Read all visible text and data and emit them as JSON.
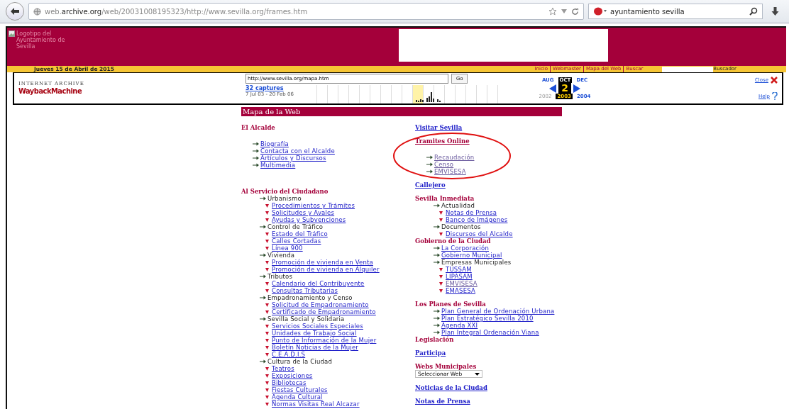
{
  "browser": {
    "address": "web.**archive.org**/web/20031008195323/http://www.sevilla.org/frames.htm",
    "search": "ayuntamiento sevilla"
  },
  "site_header": {
    "logo_alt": "Logotipo del Ayuntamiento de Sevilla",
    "date": "Jueves 15 de Abril de 2015",
    "nav": [
      "Inicio",
      "Webmaster",
      "Mapa del Web",
      "Buscar"
    ],
    "search_label": "Buscador"
  },
  "wayback": {
    "logo_top": "INTERNET ARCHIVE",
    "logo": "WaybackMachine",
    "url": "http://www.sevilla.org/mapa.htm",
    "go": "Go",
    "captures": "32 captures",
    "range": "7 Jul 03 - 20 Feb 06",
    "months": [
      {
        "label": "AUG",
        "selected": false
      },
      {
        "label": "OCT",
        "selected": true
      },
      {
        "label": "DEC",
        "selected": false
      }
    ],
    "day": "2",
    "years": [
      {
        "label": "2002",
        "selected": false,
        "disabled": true
      },
      {
        "label": "2003",
        "selected": true,
        "disabled": false
      },
      {
        "label": "2004",
        "selected": false,
        "disabled": false
      }
    ],
    "close": "Close",
    "help": "Help"
  },
  "page_title": "Mapa de la Web",
  "columns": [
    {
      "groups": [
        [
          {
            "heading": {
              "text": "El Alcalde",
              "kind": "title"
            },
            "kind": "spaced",
            "items": [
              {
                "text": "Biografía",
                "kind": "arrow-link",
                "visited": false
              },
              {
                "text": "Contacta con el Alcalde",
                "kind": "arrow-link",
                "visited": false
              },
              {
                "text": "Artículos y Discursos",
                "kind": "arrow-link",
                "visited": false
              },
              {
                "text": "Multimedia",
                "kind": "arrow-link",
                "visited": false
              }
            ]
          }
        ],
        [
          {
            "heading": {
              "text": "Al Servicio del Ciudadano",
              "kind": "title"
            },
            "kind": "compact",
            "items": [
              {
                "text": "Urbanismo",
                "kind": "arrow-text",
                "children": [
                  {
                    "text": "Procedimientos y Trámites",
                    "kind": "bullet-link",
                    "visited": false
                  },
                  {
                    "text": "Solicitudes y Avales",
                    "kind": "bullet-link",
                    "visited": false
                  },
                  {
                    "text": "Ayudas y Subvenciones",
                    "kind": "bullet-link",
                    "visited": false
                  }
                ]
              },
              {
                "text": "Control de Tráfico",
                "kind": "arrow-text",
                "children": [
                  {
                    "text": "Estado del Tráfico",
                    "kind": "bullet-link",
                    "visited": false
                  },
                  {
                    "text": "Calles Cortadas",
                    "kind": "bullet-link",
                    "visited": false
                  },
                  {
                    "text": "Línea 900",
                    "kind": "bullet-link",
                    "visited": false
                  }
                ]
              },
              {
                "text": "Vivienda",
                "kind": "arrow-text",
                "children": [
                  {
                    "text": "Promoción de vivienda en Venta",
                    "kind": "bullet-link",
                    "visited": false
                  },
                  {
                    "text": "Promoción de vivienda en Alquiler",
                    "kind": "bullet-link",
                    "visited": false
                  }
                ]
              },
              {
                "text": "Tributos",
                "kind": "arrow-text",
                "children": [
                  {
                    "text": "Calendario del Contribuyente",
                    "kind": "bullet-link",
                    "visited": false
                  },
                  {
                    "text": "Consultas Tributarias",
                    "kind": "bullet-link",
                    "visited": false
                  }
                ]
              },
              {
                "text": "Empadronamiento y Censo",
                "kind": "arrow-text",
                "children": [
                  {
                    "text": "Solicitud de Empadronamiento",
                    "kind": "bullet-link",
                    "visited": false
                  },
                  {
                    "text": "Certificado de Empadronamiento",
                    "kind": "bullet-link",
                    "visited": false
                  }
                ]
              },
              {
                "text": "Sevilla Social y Solidaria",
                "kind": "arrow-text",
                "children": [
                  {
                    "text": "Servicios Sociales Especiales",
                    "kind": "bullet-link",
                    "visited": false
                  },
                  {
                    "text": "Unidades de Trabajo Social",
                    "kind": "bullet-link",
                    "visited": false
                  },
                  {
                    "text": "Punto de Información de la Mujer",
                    "kind": "bullet-link",
                    "visited": false
                  },
                  {
                    "text": "Boletín Noticias de la Mujer",
                    "kind": "bullet-link",
                    "visited": false
                  },
                  {
                    "text": "C.E.A.D.I.S",
                    "kind": "bullet-link",
                    "visited": false
                  }
                ]
              },
              {
                "text": "Cultura de la Ciudad",
                "kind": "arrow-text",
                "children": [
                  {
                    "text": "Teatros",
                    "kind": "bullet-link",
                    "visited": false
                  },
                  {
                    "text": "Exposiciones",
                    "kind": "bullet-link",
                    "visited": false
                  },
                  {
                    "text": "Bibliotecas",
                    "kind": "bullet-link",
                    "visited": false
                  },
                  {
                    "text": "Fiestas Culturales",
                    "kind": "bullet-link",
                    "visited": false
                  },
                  {
                    "text": "Agenda Cultural",
                    "kind": "bullet-link",
                    "visited": false
                  },
                  {
                    "text": "Normas Visitas Real Alcazar",
                    "kind": "bullet-link",
                    "visited": false
                  }
                ]
              }
            ]
          }
        ]
      ]
    },
    {
      "groups": [
        [
          {
            "heading": {
              "text": "Visitar Sevilla",
              "kind": "link"
            },
            "kind": "compact"
          }
        ],
        [
          {
            "heading": {
              "text": "Tramites Online",
              "kind": "title-link"
            },
            "kind": "spaced",
            "items": [
              {
                "text": "Recaudación",
                "kind": "arrow-link",
                "visited": true
              },
              {
                "text": "Censo",
                "kind": "arrow-link",
                "visited": true
              },
              {
                "text": "EMVISESA",
                "kind": "arrow-link",
                "visited": true
              }
            ]
          }
        ],
        [
          {
            "heading": {
              "text": "Callejero",
              "kind": "link"
            },
            "kind": "compact"
          }
        ],
        [
          {
            "heading": {
              "text": "Sevilla Inmediata",
              "kind": "title"
            },
            "kind": "compact",
            "items": [
              {
                "text": "Actualidad",
                "kind": "arrow-text",
                "children": [
                  {
                    "text": "Notas de Prensa",
                    "kind": "bullet-link",
                    "visited": false
                  },
                  {
                    "text": "Banco de Imágenes",
                    "kind": "bullet-link",
                    "visited": false
                  }
                ]
              },
              {
                "text": "Documentos",
                "kind": "arrow-text",
                "children": [
                  {
                    "text": "Discursos del Alcalde",
                    "kind": "bullet-link",
                    "visited": false
                  }
                ]
              }
            ]
          },
          {
            "heading": {
              "text": "Gobierno de la Ciudad",
              "kind": "title"
            },
            "kind": "compact",
            "items": [
              {
                "text": "La Corporación",
                "kind": "arrow-link",
                "visited": false
              },
              {
                "text": "Gobierno Municipal",
                "kind": "arrow-link",
                "visited": false
              },
              {
                "text": "Empresas Municipales",
                "kind": "arrow-text",
                "children": [
                  {
                    "text": "TUSSAM",
                    "kind": "bullet-link",
                    "visited": false
                  },
                  {
                    "text": "LIPASAM",
                    "kind": "bullet-link",
                    "visited": false
                  },
                  {
                    "text": "EMVISESA",
                    "kind": "bullet-link",
                    "visited": true
                  },
                  {
                    "text": "EMASESA",
                    "kind": "bullet-link",
                    "visited": false
                  }
                ]
              }
            ]
          }
        ],
        [
          {
            "heading": {
              "text": "Los Planes de Sevilla",
              "kind": "title"
            },
            "kind": "compact",
            "items": [
              {
                "text": "Plan General de Ordenación Urbana",
                "kind": "arrow-link",
                "visited": false
              },
              {
                "text": "Plan Estratégico Sevilla 2010",
                "kind": "arrow-link",
                "visited": false
              },
              {
                "text": "Agenda XXI",
                "kind": "arrow-link",
                "visited": false
              },
              {
                "text": "Plan Integral Ordenación Viana",
                "kind": "arrow-link",
                "visited": false
              }
            ]
          },
          {
            "heading": {
              "text": "Legislación",
              "kind": "title"
            },
            "kind": "compact"
          }
        ],
        [
          {
            "heading": {
              "text": "Participa",
              "kind": "link"
            },
            "kind": "compact"
          }
        ],
        [
          {
            "heading": {
              "text": "Webs Municipales",
              "kind": "title"
            },
            "kind": "compact",
            "select": "Seleccionar Web"
          }
        ],
        [
          {
            "heading": {
              "text": "Noticias de la Ciudad",
              "kind": "link"
            },
            "kind": "compact"
          }
        ],
        [
          {
            "heading": {
              "text": "Notas de Prensa",
              "kind": "link"
            },
            "kind": "compact"
          }
        ]
      ]
    }
  ],
  "annotation": {
    "kind": "ellipse"
  }
}
